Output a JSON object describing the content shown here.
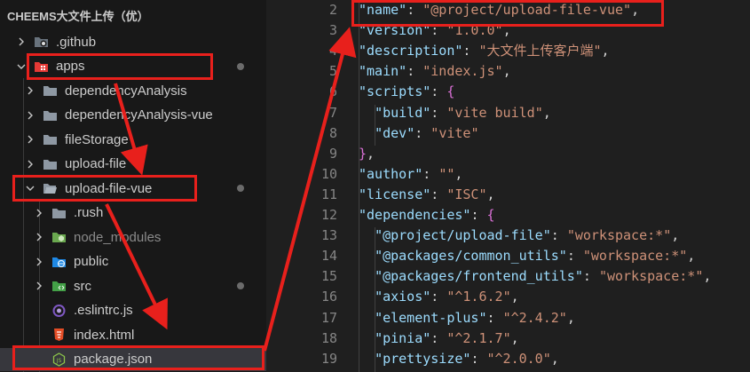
{
  "explorer": {
    "title": "CHEEMS大文件上传（优）",
    "items": [
      {
        "label": ".github",
        "icon": "github-folder-icon",
        "chevron": "right"
      },
      {
        "label": "apps",
        "icon": "apps-folder-icon",
        "chevron": "down",
        "modified": true
      },
      {
        "label": "dependencyAnalysis",
        "icon": "folder-icon",
        "chevron": "right"
      },
      {
        "label": "dependencyAnalysis-vue",
        "icon": "folder-icon",
        "chevron": "right"
      },
      {
        "label": "fileStorage",
        "icon": "folder-icon",
        "chevron": "right"
      },
      {
        "label": "upload-file",
        "icon": "folder-icon",
        "chevron": "right"
      },
      {
        "label": "upload-file-vue",
        "icon": "folder-open-icon",
        "chevron": "down",
        "modified": true
      },
      {
        "label": ".rush",
        "icon": "folder-icon",
        "chevron": "right"
      },
      {
        "label": "node_modules",
        "icon": "node-folder-icon",
        "chevron": "right",
        "dimmed": true
      },
      {
        "label": "public",
        "icon": "globe-folder-icon",
        "chevron": "right"
      },
      {
        "label": "src",
        "icon": "src-folder-icon",
        "chevron": "right",
        "modified": true
      },
      {
        "label": ".eslintrc.js",
        "icon": "eslint-icon"
      },
      {
        "label": "index.html",
        "icon": "html5-icon"
      },
      {
        "label": "package.json",
        "icon": "nodejs-file-icon",
        "selected": true
      }
    ]
  },
  "editor": {
    "lines": [
      {
        "n": "2",
        "key": "name",
        "value": "@project/upload-file-vue"
      },
      {
        "n": "3",
        "key": "version",
        "value": "1.0.0"
      },
      {
        "n": "4",
        "key": "description",
        "value": "大文件上传客户端"
      },
      {
        "n": "5",
        "key": "main",
        "value": "index.js"
      },
      {
        "n": "6",
        "key": "scripts",
        "open": "{"
      },
      {
        "n": "7",
        "key": "build",
        "value": "vite build",
        "indent": 2
      },
      {
        "n": "8",
        "key": "dev",
        "value": "vite",
        "indent": 2,
        "last": true
      },
      {
        "n": "9",
        "close": "},"
      },
      {
        "n": "10",
        "key": "author",
        "value": ""
      },
      {
        "n": "11",
        "key": "license",
        "value": "ISC"
      },
      {
        "n": "12",
        "key": "dependencies",
        "open": "{"
      },
      {
        "n": "13",
        "key": "@project/upload-file",
        "value": "workspace:*",
        "indent": 2
      },
      {
        "n": "14",
        "key": "@packages/common_utils",
        "value": "workspace:*",
        "indent": 2
      },
      {
        "n": "15",
        "key": "@packages/frontend_utils",
        "value": "workspace:*",
        "indent": 2
      },
      {
        "n": "16",
        "key": "axios",
        "value": "^1.6.2",
        "indent": 2
      },
      {
        "n": "17",
        "key": "element-plus",
        "value": "^2.4.2",
        "indent": 2
      },
      {
        "n": "18",
        "key": "pinia",
        "value": "^2.1.7",
        "indent": 2
      },
      {
        "n": "19",
        "key": "prettysize",
        "value": "^2.0.0",
        "indent": 2
      }
    ]
  },
  "colors": {
    "annotation_red": "#e8201c",
    "json_key": "#9cdcfe",
    "json_string": "#ce9178",
    "brace": "#da70d6"
  }
}
